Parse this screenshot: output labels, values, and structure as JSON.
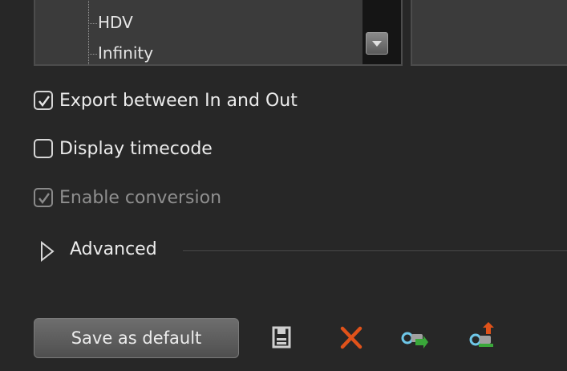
{
  "format_list": {
    "items": [
      "HDV",
      "Infinity"
    ]
  },
  "options": {
    "export_between_label": "Export between In and Out",
    "export_between_checked": true,
    "display_timecode_label": "Display timecode",
    "display_timecode_checked": false,
    "enable_conversion_label": "Enable conversion",
    "enable_conversion_checked": true,
    "enable_conversion_enabled": false
  },
  "advanced": {
    "label": "Advanced",
    "expanded": false
  },
  "toolbar": {
    "save_default_label": "Save as default",
    "icons": [
      "save-icon",
      "delete-icon",
      "import-preset-icon",
      "export-preset-icon"
    ]
  },
  "colors": {
    "background": "#272727",
    "panel": "#3b3b3b",
    "delete_accent": "#e0521a",
    "arrow_green": "#3aa83a"
  }
}
